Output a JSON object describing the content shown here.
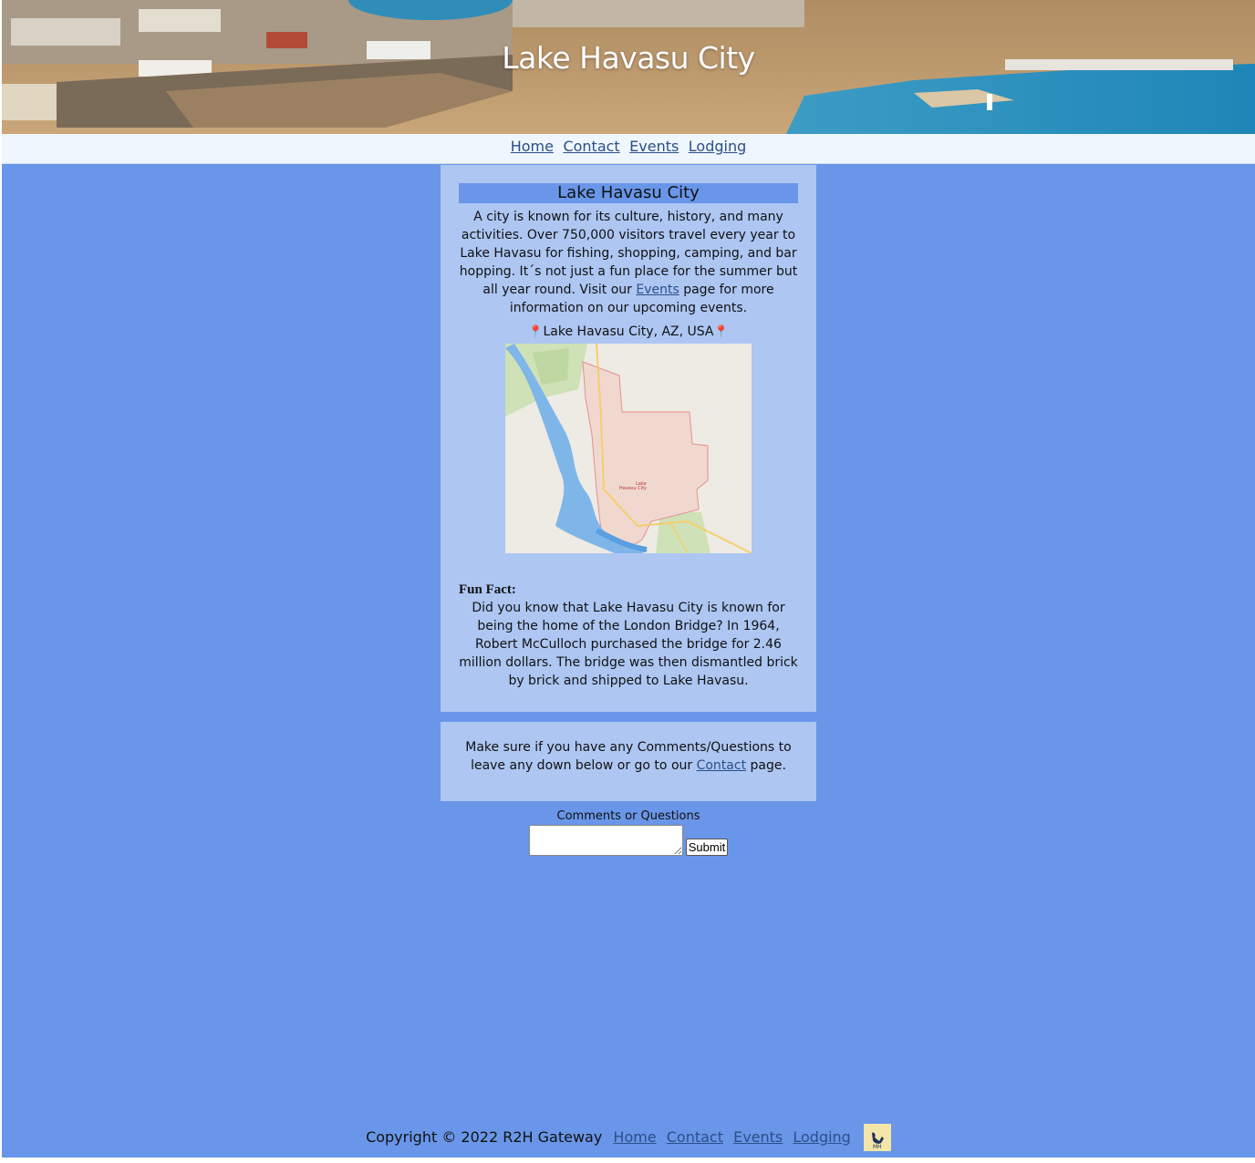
{
  "header": {
    "title": "Lake Havasu City"
  },
  "nav": {
    "items": [
      "Home",
      "Contact",
      "Events",
      "Lodging"
    ]
  },
  "main": {
    "heading": "Lake Havasu City",
    "intro_before_link": "A city is known for its culture, history, and many activities. Over 750,000 visitors travel every year to Lake Havasu for fishing, shopping, camping, and bar hopping. It´s not just a fun place for the summer but all year round. Visit our ",
    "intro_link": "Events",
    "intro_after_link": " page for more information on our upcoming events.",
    "location": "Lake Havasu City, AZ, USA",
    "pin_icon": "📍",
    "funfact_title": "Fun Fact:",
    "funfact_text": "Did you know that Lake Havasu City is known for being the home of the London Bridge? In 1964, Robert McCulloch purchased the bridge for 2.46 million dollars. The bridge was then dismantled brick by brick and shipped to Lake Havasu."
  },
  "comments_card": {
    "text_before_link": "Make sure if you have any Comments/Questions to leave any down below or go to our ",
    "link": "Contact",
    "text_after_link": " page."
  },
  "form": {
    "label": "Comments or Questions",
    "textarea_value": "",
    "submit_label": "Submit"
  },
  "footer": {
    "copyright": "Copyright © 2022 R2H Gateway",
    "links": [
      "Home",
      "Contact",
      "Events",
      "Lodging"
    ]
  },
  "colors": {
    "page_bg": "#6996e8",
    "card_bg": "#adc6f2",
    "nav_bg": "#eff6fd",
    "link": "#2b4f8a"
  }
}
